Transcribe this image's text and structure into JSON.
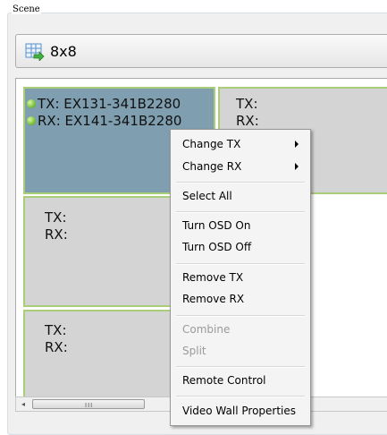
{
  "group": {
    "label": "Scene"
  },
  "combo": {
    "value": "8x8",
    "icon": "grid-arrow-icon"
  },
  "cells": [
    {
      "tx": "TX: EX131-341B2280",
      "rx": "RX: EX141-341B2280"
    },
    {
      "tx": "TX:",
      "rx": "RX:"
    },
    {
      "tx": "TX:",
      "rx": "RX:"
    },
    {
      "tx": "TX:",
      "rx": "RX:"
    }
  ],
  "scrollbar": {
    "left_arrow": "◂",
    "grip": "III"
  },
  "menu": {
    "items": [
      {
        "label": "Change TX",
        "submenu": true,
        "enabled": true
      },
      {
        "label": "Change RX",
        "submenu": true,
        "enabled": true
      },
      {
        "label": "Select All",
        "enabled": true
      },
      {
        "label": "Turn OSD On",
        "enabled": true
      },
      {
        "label": "Turn OSD Off",
        "enabled": true
      },
      {
        "label": "Remove TX",
        "enabled": true
      },
      {
        "label": "Remove RX",
        "enabled": true
      },
      {
        "label": "Combine",
        "enabled": false
      },
      {
        "label": "Split",
        "enabled": false
      },
      {
        "label": "Remote Control",
        "enabled": true
      },
      {
        "label": "Video Wall Properties",
        "enabled": true
      }
    ]
  },
  "colors": {
    "selected_cell": "#7f9eb0",
    "cell": "#d4d4d4",
    "cell_border": "#aacd79",
    "status_led": "#6bb728"
  }
}
